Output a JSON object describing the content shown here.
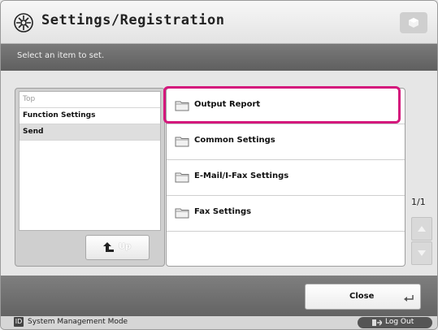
{
  "header": {
    "title": "Settings/Registration"
  },
  "instruction": "Select an item to set.",
  "tree": {
    "items": [
      {
        "label": "Top"
      },
      {
        "label": "Function Settings"
      },
      {
        "label": "Send"
      }
    ],
    "up_label": "Up"
  },
  "list": {
    "items": [
      {
        "label": "Output Report"
      },
      {
        "label": "Common Settings"
      },
      {
        "label": "E-Mail/I-Fax Settings"
      },
      {
        "label": "Fax Settings"
      }
    ],
    "highlight_color": "#d4187c"
  },
  "pager": {
    "page": "1/1"
  },
  "footer": {
    "close_label": "Close"
  },
  "status": {
    "id_badge": "ID",
    "mode": "System Management Mode",
    "logout_label": "Log Out"
  }
}
